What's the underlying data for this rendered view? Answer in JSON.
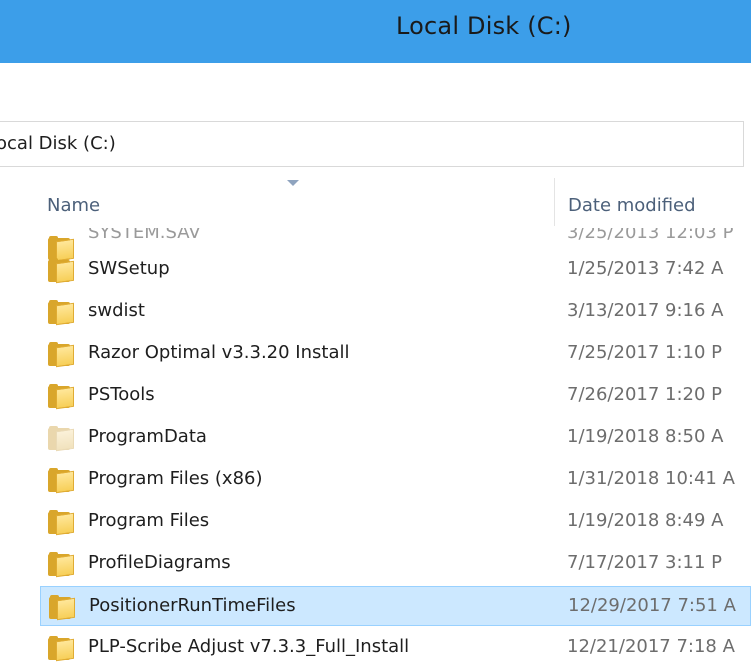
{
  "window": {
    "title": "Local Disk (C:)"
  },
  "address_bar": {
    "path": "ocal Disk (C:)"
  },
  "file_list": {
    "columns": {
      "name": "Name",
      "date_modified": "Date modified"
    },
    "rows": [
      {
        "name": "SYSTEM.SAV",
        "date": "3/25/2013 12:03 P",
        "partial": true,
        "icon": "folder-icon"
      },
      {
        "name": "SWSetup",
        "date": "1/25/2013 7:42 A",
        "icon": "folder-icon"
      },
      {
        "name": "swdist",
        "date": "3/13/2017 9:16 A",
        "icon": "folder-icon"
      },
      {
        "name": "Razor Optimal v3.3.20 Install",
        "date": "7/25/2017 1:10 P",
        "icon": "folder-icon"
      },
      {
        "name": "PSTools",
        "date": "7/26/2017 1:20 P",
        "icon": "folder-icon"
      },
      {
        "name": "ProgramData",
        "date": "1/19/2018 8:50 A",
        "icon": "folder-hidden-icon"
      },
      {
        "name": "Program Files (x86)",
        "date": "1/31/2018 10:41 A",
        "icon": "folder-icon"
      },
      {
        "name": "Program Files",
        "date": "1/19/2018 8:49 A",
        "icon": "folder-icon"
      },
      {
        "name": "ProfileDiagrams",
        "date": "7/17/2017 3:11 P",
        "icon": "folder-icon"
      },
      {
        "name": "PositionerRunTimeFiles",
        "date": "12/29/2017 7:51 A",
        "icon": "folder-icon",
        "selected": true
      },
      {
        "name": "PLP-Scribe Adjust v7.3.3_Full_Install",
        "date": "12/21/2017 7:18 A",
        "icon": "folder-icon"
      }
    ]
  }
}
